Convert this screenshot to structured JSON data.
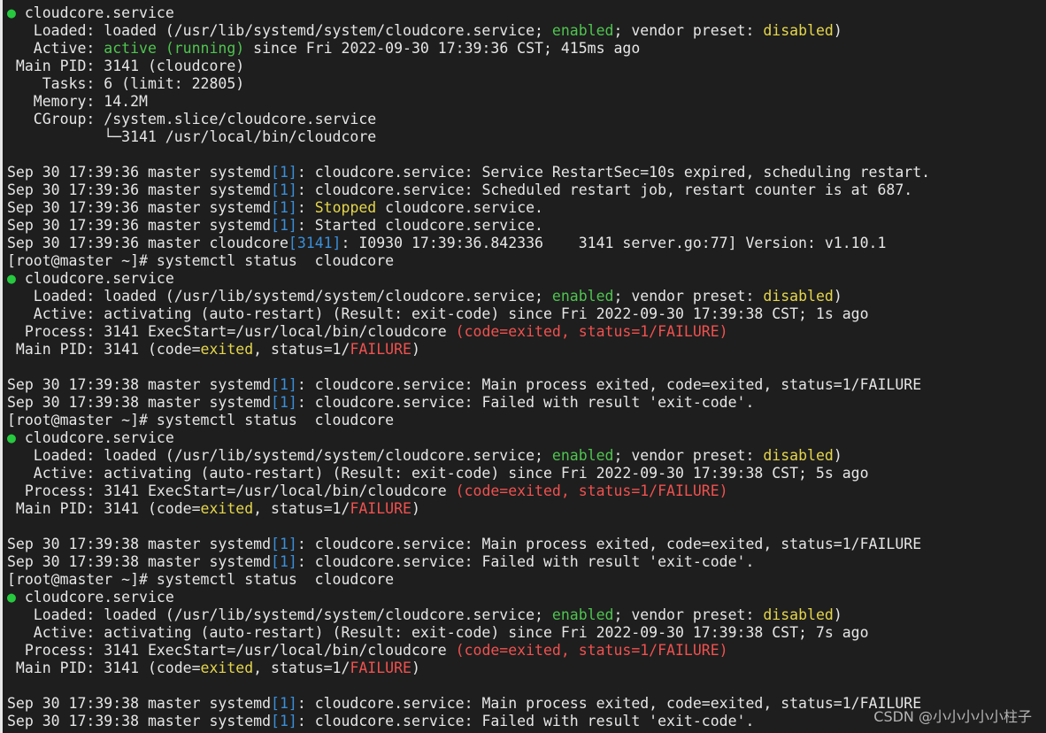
{
  "colors": {
    "background": "#1e1e1e",
    "default": "#e6e6e6",
    "green": "#4fc44f",
    "yellow": "#e5d64b",
    "red": "#f0514f",
    "blue": "#3a8fd9",
    "bullet": "#27c93f"
  },
  "watermark": "CSDN @小小小小小柱子",
  "lines": [
    [
      [
        "bullet",
        "●"
      ],
      [
        "default",
        " cloudcore.service"
      ]
    ],
    [
      [
        "default",
        "   Loaded: loaded (/usr/lib/systemd/system/cloudcore.service; "
      ],
      [
        "green",
        "enabled"
      ],
      [
        "default",
        "; vendor preset: "
      ],
      [
        "yellow",
        "disabled"
      ],
      [
        "default",
        ")"
      ]
    ],
    [
      [
        "default",
        "   Active: "
      ],
      [
        "green",
        "active (running)"
      ],
      [
        "default",
        " since Fri 2022-09-30 17:39:36 CST; 415ms ago"
      ]
    ],
    [
      [
        "default",
        " Main PID: 3141 (cloudcore)"
      ]
    ],
    [
      [
        "default",
        "    Tasks: 6 (limit: 22805)"
      ]
    ],
    [
      [
        "default",
        "   Memory: 14.2M"
      ]
    ],
    [
      [
        "default",
        "   CGroup: /system.slice/cloudcore.service"
      ]
    ],
    [
      [
        "default",
        "           └─3141 /usr/local/bin/cloudcore"
      ]
    ],
    [
      [
        "default",
        ""
      ]
    ],
    [
      [
        "default",
        "Sep 30 17:39:36 master systemd"
      ],
      [
        "blue",
        "[1]"
      ],
      [
        "default",
        ": cloudcore.service: Service RestartSec=10s expired, scheduling restart."
      ]
    ],
    [
      [
        "default",
        "Sep 30 17:39:36 master systemd"
      ],
      [
        "blue",
        "[1]"
      ],
      [
        "default",
        ": cloudcore.service: Scheduled restart job, restart counter is at 687."
      ]
    ],
    [
      [
        "default",
        "Sep 30 17:39:36 master systemd"
      ],
      [
        "blue",
        "[1]"
      ],
      [
        "default",
        ": "
      ],
      [
        "yellow",
        "Stopped"
      ],
      [
        "default",
        " cloudcore.service."
      ]
    ],
    [
      [
        "default",
        "Sep 30 17:39:36 master systemd"
      ],
      [
        "blue",
        "[1]"
      ],
      [
        "default",
        ": Started cloudcore.service."
      ]
    ],
    [
      [
        "default",
        "Sep 30 17:39:36 master cloudcore"
      ],
      [
        "blue",
        "[3141]"
      ],
      [
        "default",
        ": I0930 17:39:36.842336    3141 server.go:77] Version: v1.10.1"
      ]
    ],
    [
      [
        "default",
        "[root@master ~]# systemctl status  cloudcore"
      ]
    ],
    [
      [
        "bullet",
        "●"
      ],
      [
        "default",
        " cloudcore.service"
      ]
    ],
    [
      [
        "default",
        "   Loaded: loaded (/usr/lib/systemd/system/cloudcore.service; "
      ],
      [
        "green",
        "enabled"
      ],
      [
        "default",
        "; vendor preset: "
      ],
      [
        "yellow",
        "disabled"
      ],
      [
        "default",
        ")"
      ]
    ],
    [
      [
        "default",
        "   Active: activating (auto-restart) (Result: exit-code) since Fri 2022-09-30 17:39:38 CST; 1s ago"
      ]
    ],
    [
      [
        "default",
        "  Process: 3141 ExecStart=/usr/local/bin/cloudcore "
      ],
      [
        "red",
        "(code=exited, status=1/FAILURE)"
      ]
    ],
    [
      [
        "default",
        " Main PID: 3141 (code="
      ],
      [
        "yellow",
        "exited"
      ],
      [
        "default",
        ", status=1/"
      ],
      [
        "red",
        "FAILURE"
      ],
      [
        "default",
        ")"
      ]
    ],
    [
      [
        "default",
        ""
      ]
    ],
    [
      [
        "default",
        "Sep 30 17:39:38 master systemd"
      ],
      [
        "blue",
        "[1]"
      ],
      [
        "default",
        ": cloudcore.service: Main process exited, code=exited, status=1/FAILURE"
      ]
    ],
    [
      [
        "default",
        "Sep 30 17:39:38 master systemd"
      ],
      [
        "blue",
        "[1]"
      ],
      [
        "default",
        ": cloudcore.service: Failed with result 'exit-code'."
      ]
    ],
    [
      [
        "default",
        "[root@master ~]# systemctl status  cloudcore"
      ]
    ],
    [
      [
        "bullet",
        "●"
      ],
      [
        "default",
        " cloudcore.service"
      ]
    ],
    [
      [
        "default",
        "   Loaded: loaded (/usr/lib/systemd/system/cloudcore.service; "
      ],
      [
        "green",
        "enabled"
      ],
      [
        "default",
        "; vendor preset: "
      ],
      [
        "yellow",
        "disabled"
      ],
      [
        "default",
        ")"
      ]
    ],
    [
      [
        "default",
        "   Active: activating (auto-restart) (Result: exit-code) since Fri 2022-09-30 17:39:38 CST; 5s ago"
      ]
    ],
    [
      [
        "default",
        "  Process: 3141 ExecStart=/usr/local/bin/cloudcore "
      ],
      [
        "red",
        "(code=exited, status=1/FAILURE)"
      ]
    ],
    [
      [
        "default",
        " Main PID: 3141 (code="
      ],
      [
        "yellow",
        "exited"
      ],
      [
        "default",
        ", status=1/"
      ],
      [
        "red",
        "FAILURE"
      ],
      [
        "default",
        ")"
      ]
    ],
    [
      [
        "default",
        ""
      ]
    ],
    [
      [
        "default",
        "Sep 30 17:39:38 master systemd"
      ],
      [
        "blue",
        "[1]"
      ],
      [
        "default",
        ": cloudcore.service: Main process exited, code=exited, status=1/FAILURE"
      ]
    ],
    [
      [
        "default",
        "Sep 30 17:39:38 master systemd"
      ],
      [
        "blue",
        "[1]"
      ],
      [
        "default",
        ": cloudcore.service: Failed with result 'exit-code'."
      ]
    ],
    [
      [
        "default",
        "[root@master ~]# systemctl status  cloudcore"
      ]
    ],
    [
      [
        "bullet",
        "●"
      ],
      [
        "default",
        " cloudcore.service"
      ]
    ],
    [
      [
        "default",
        "   Loaded: loaded (/usr/lib/systemd/system/cloudcore.service; "
      ],
      [
        "green",
        "enabled"
      ],
      [
        "default",
        "; vendor preset: "
      ],
      [
        "yellow",
        "disabled"
      ],
      [
        "default",
        ")"
      ]
    ],
    [
      [
        "default",
        "   Active: activating (auto-restart) (Result: exit-code) since Fri 2022-09-30 17:39:38 CST; 7s ago"
      ]
    ],
    [
      [
        "default",
        "  Process: 3141 ExecStart=/usr/local/bin/cloudcore "
      ],
      [
        "red",
        "(code=exited, status=1/FAILURE)"
      ]
    ],
    [
      [
        "default",
        " Main PID: 3141 (code="
      ],
      [
        "yellow",
        "exited"
      ],
      [
        "default",
        ", status=1/"
      ],
      [
        "red",
        "FAILURE"
      ],
      [
        "default",
        ")"
      ]
    ],
    [
      [
        "default",
        ""
      ]
    ],
    [
      [
        "default",
        "Sep 30 17:39:38 master systemd"
      ],
      [
        "blue",
        "[1]"
      ],
      [
        "default",
        ": cloudcore.service: Main process exited, code=exited, status=1/FAILURE"
      ]
    ],
    [
      [
        "default",
        "Sep 30 17:39:38 master systemd"
      ],
      [
        "blue",
        "[1]"
      ],
      [
        "default",
        ": cloudcore.service: Failed with result 'exit-code'."
      ]
    ]
  ]
}
